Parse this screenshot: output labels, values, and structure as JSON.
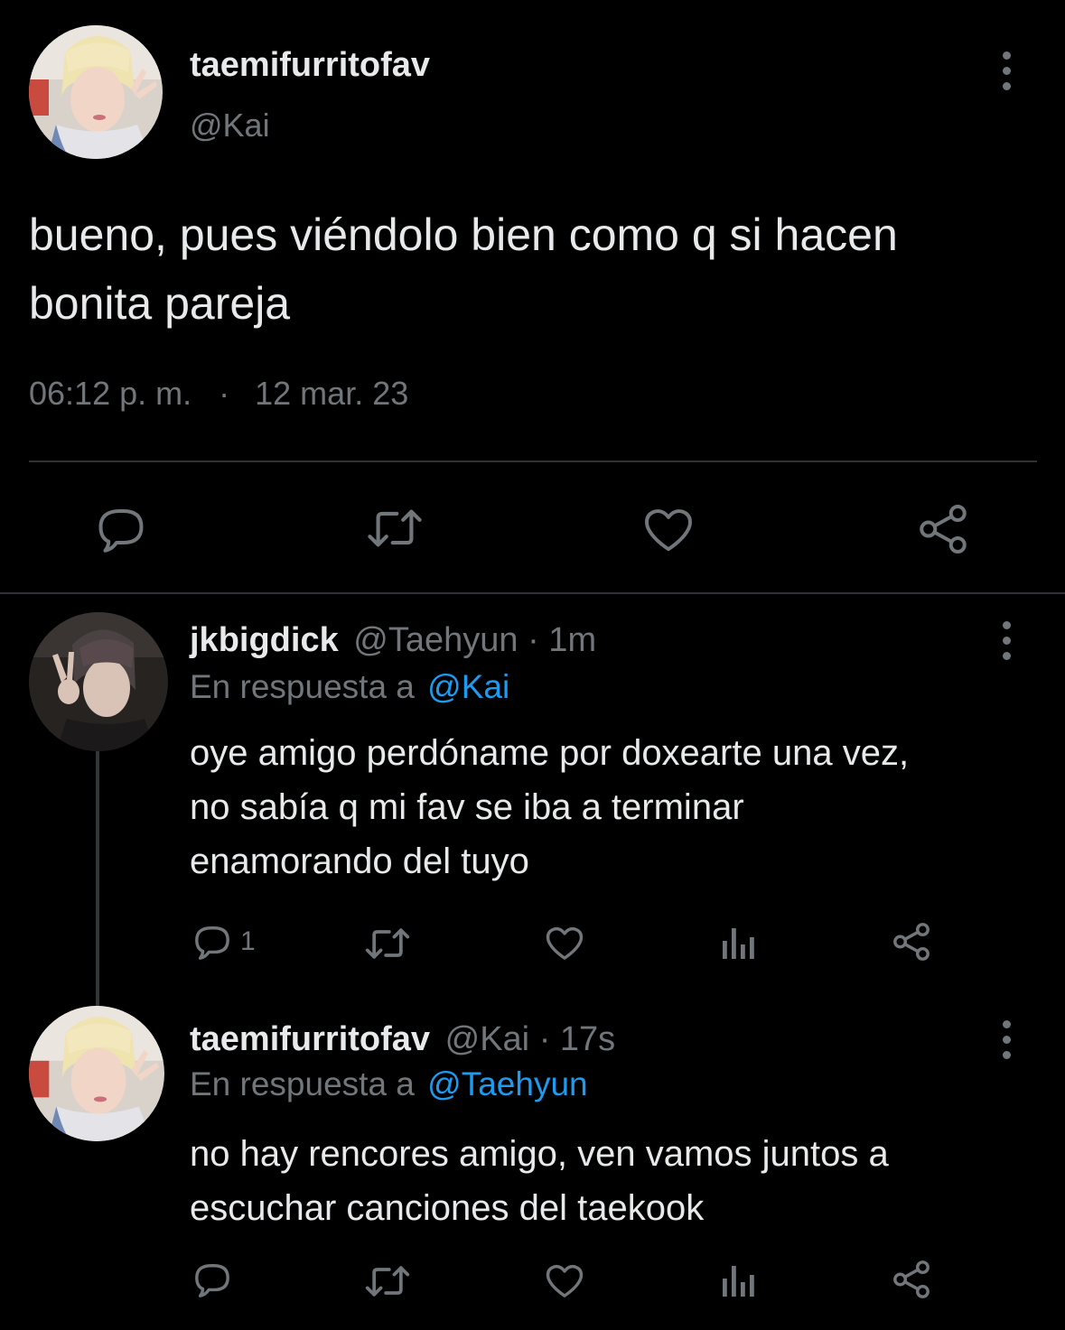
{
  "main_tweet": {
    "display_name": "taemifurritofav",
    "handle": "@Kai",
    "text_line1": "bueno, pues viéndolo bien como q si hacen",
    "text_line2": "bonita pareja",
    "time": "06:12 p. m.",
    "separator": "·",
    "date": "12 mar. 23",
    "actions": [
      "reply-icon",
      "retweet-icon",
      "like-icon",
      "share-icon"
    ]
  },
  "reply1": {
    "display_name": "jkbigdick",
    "handle": "@Taehyun",
    "age": "· 1m",
    "in_reply_prefix": "En respuesta a",
    "in_reply_handle": "@Kai",
    "text_line1": "oye amigo perdóname por doxearte una vez,",
    "text_line2": "no sabía q mi fav se iba a terminar",
    "text_line3": "enamorando del tuyo",
    "reply_count": "1",
    "actions": [
      "reply-icon",
      "retweet-icon",
      "like-icon",
      "analytics-icon",
      "share-icon"
    ]
  },
  "reply2": {
    "display_name": "taemifurritofav",
    "handle": "@Kai",
    "age": "· 17s",
    "in_reply_prefix": "En respuesta a",
    "in_reply_handle": "@Taehyun",
    "text_line1": "no hay rencores amigo, ven vamos juntos a",
    "text_line2": "escuchar canciones del taekook",
    "actions": [
      "reply-icon",
      "retweet-icon",
      "like-icon",
      "analytics-icon",
      "share-icon"
    ]
  },
  "colors": {
    "background": "#000000",
    "text": "#e7e9ea",
    "secondary": "#71767b",
    "link": "#1d9bf0",
    "divider": "#2f3336"
  }
}
